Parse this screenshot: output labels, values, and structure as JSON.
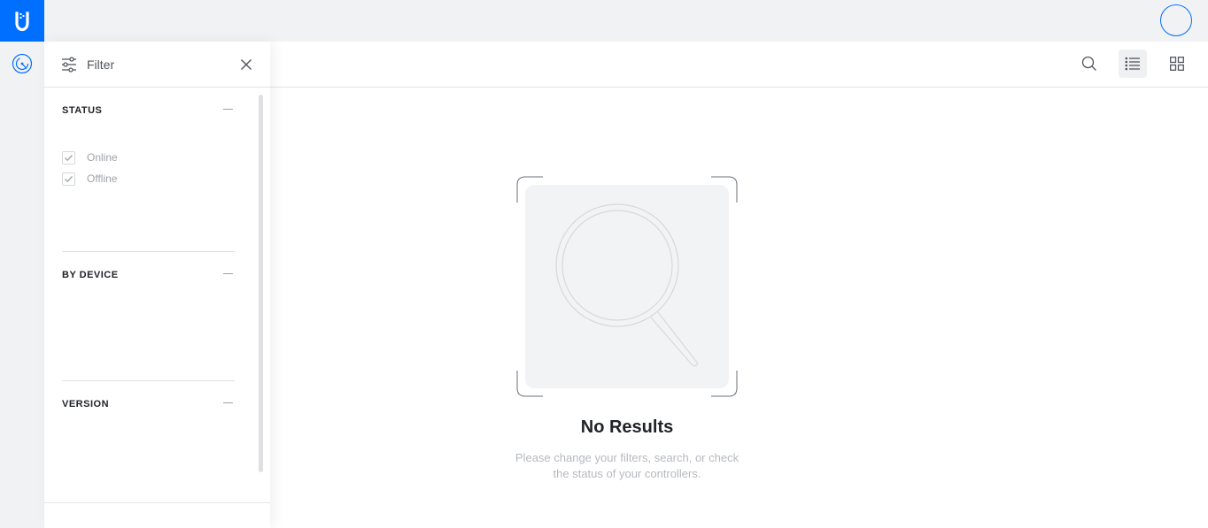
{
  "app": {
    "brand_color": "#006fff",
    "logo_icon": "ubiquiti-u-logo",
    "avatar_icon": "user-avatar"
  },
  "sidenav": {
    "items": [
      {
        "icon": "controller-dial-icon",
        "active": true
      }
    ]
  },
  "filter": {
    "title": "Filter",
    "sections": [
      {
        "title": "STATUS",
        "options": [
          {
            "label": "Online",
            "checked": true
          },
          {
            "label": "Offline",
            "checked": true
          }
        ]
      },
      {
        "title": "BY DEVICE",
        "options": []
      },
      {
        "title": "VERSION",
        "options": []
      }
    ]
  },
  "toolbar": {
    "buttons": [
      {
        "icon": "search-icon",
        "active": false
      },
      {
        "icon": "list-view-icon",
        "active": true
      },
      {
        "icon": "grid-view-icon",
        "active": false
      }
    ]
  },
  "empty_state": {
    "icon": "magnifier-icon",
    "title": "No Results",
    "message_line1": "Please change your filters, search, or check",
    "message_line2": "the status of your controllers."
  }
}
